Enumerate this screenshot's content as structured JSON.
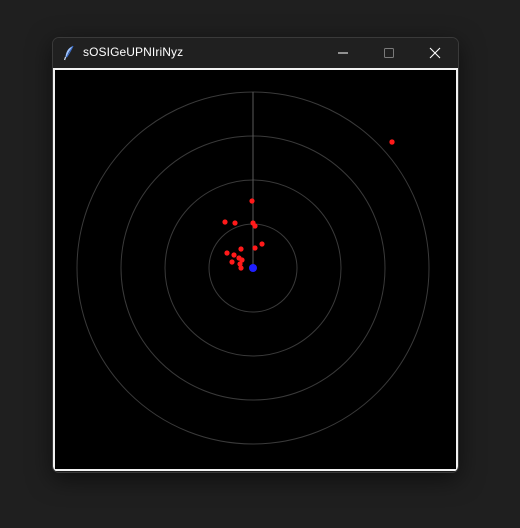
{
  "window": {
    "title": "sOSIGeUPNIriNyz",
    "app_icon": "feather-pen-icon",
    "controls": {
      "minimize_icon": "minimize-icon",
      "maximize_icon": "maximize-icon",
      "close_icon": "close-icon"
    }
  },
  "canvas": {
    "background": "#000000",
    "ring_color": "#3a3a3a",
    "center_marker": {
      "color": "#1f1fff",
      "icon": "center-dot"
    },
    "targets": {
      "color": "#ff1a1a",
      "count": 17
    }
  }
}
